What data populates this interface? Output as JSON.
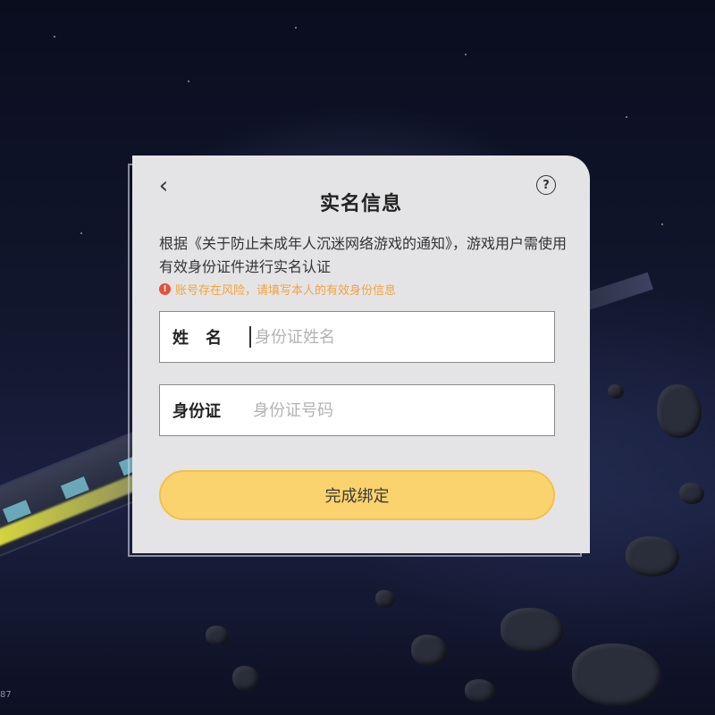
{
  "dialog": {
    "title": "实名信息",
    "back_icon": "chevron-left-icon",
    "help_icon": "help-icon",
    "notice": "根据《关于防止未成年人沉迷网络游戏的通知》，游戏用户需使用有效身份证件进行实名认证",
    "warning": "账号存在风险，请填写本人的有效身份信息",
    "warning_icon": "warning-icon",
    "fields": [
      {
        "label": "姓名",
        "placeholder": "身份证姓名",
        "value": ""
      },
      {
        "label": "身份证",
        "placeholder": "身份证号码",
        "value": ""
      }
    ],
    "submit_label": "完成绑定",
    "colors": {
      "submit_bg": "#fbd36e",
      "warning_text": "#f3a33a",
      "warning_icon": "#e8503a",
      "dialog_bg": "#e4e4e6"
    }
  },
  "corner_text": "87"
}
